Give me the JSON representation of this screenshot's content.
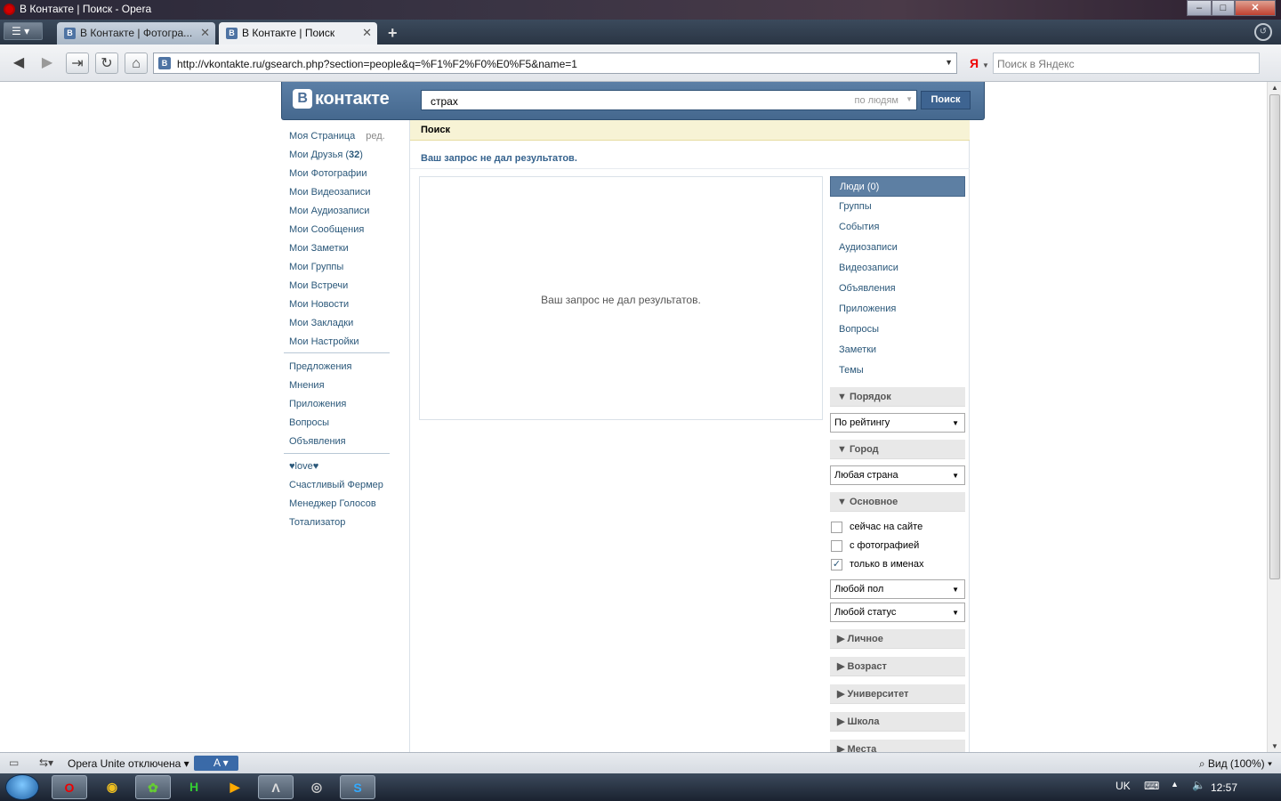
{
  "window": {
    "title": "В Контакте | Поиск - Opera",
    "minimize": "–",
    "maximize": "□",
    "close": "✕"
  },
  "tabs": [
    {
      "label": "В Контакте | Фотогра...",
      "active": false
    },
    {
      "label": "В Контакте | Поиск",
      "active": true
    }
  ],
  "new_tab": "+",
  "address_bar": {
    "url": "http://vkontakte.ru/gsearch.php?section=people&q=%F1%F2%F0%E0%F5&name=1",
    "search_engine": "Я",
    "search_placeholder": "Поиск в Яндекс"
  },
  "vk": {
    "logo": "контакте",
    "logo_letter": "В",
    "search_value": "страх",
    "search_scope": "по людям",
    "search_button": "Поиск"
  },
  "left_nav": {
    "main": [
      {
        "label": "Моя Страница",
        "extra": "ред."
      },
      {
        "label": "Мои Друзья",
        "count": "32"
      },
      {
        "label": "Мои Фотографии"
      },
      {
        "label": "Мои Видеозаписи"
      },
      {
        "label": "Мои Аудиозаписи"
      },
      {
        "label": "Мои Сообщения"
      },
      {
        "label": "Мои Заметки"
      },
      {
        "label": "Мои Группы"
      },
      {
        "label": "Мои Встречи"
      },
      {
        "label": "Мои Новости"
      },
      {
        "label": "Мои Закладки"
      },
      {
        "label": "Мои Настройки"
      }
    ],
    "secondary": [
      "Предложения",
      "Мнения",
      "Приложения",
      "Вопросы",
      "Объявления"
    ],
    "apps": [
      "♥love♥",
      "Счастливый Фермер",
      "Менеджер Голосов",
      "Тотализатор"
    ]
  },
  "content": {
    "header": "Поиск",
    "no_results_title": "Ваш запрос не дал результатов.",
    "no_results_message": "Ваш запрос не дал результатов."
  },
  "filter": {
    "sections": [
      "Люди (0)",
      "Группы",
      "События",
      "Аудиозаписи",
      "Видеозаписи",
      "Объявления",
      "Приложения",
      "Вопросы",
      "Заметки",
      "Темы"
    ],
    "order_header": "Порядок",
    "order_value": "По рейтингу",
    "city_header": "Город",
    "city_value": "Любая страна",
    "basic_header": "Основное",
    "checkboxes": [
      {
        "label": "сейчас на сайте",
        "checked": false
      },
      {
        "label": "с фотографией",
        "checked": false
      },
      {
        "label": "только в именах",
        "checked": true
      }
    ],
    "gender_value": "Любой пол",
    "status_value": "Любой статус",
    "collapsed_headers": [
      "Личное",
      "Возраст",
      "Университет",
      "Школа",
      "Места"
    ]
  },
  "status_bar": {
    "unite": "Opera Unite отключена",
    "chip": "A",
    "zoom": "Вид (100%)"
  },
  "taskbar": {
    "lang": "UK",
    "clock": "12:57"
  }
}
